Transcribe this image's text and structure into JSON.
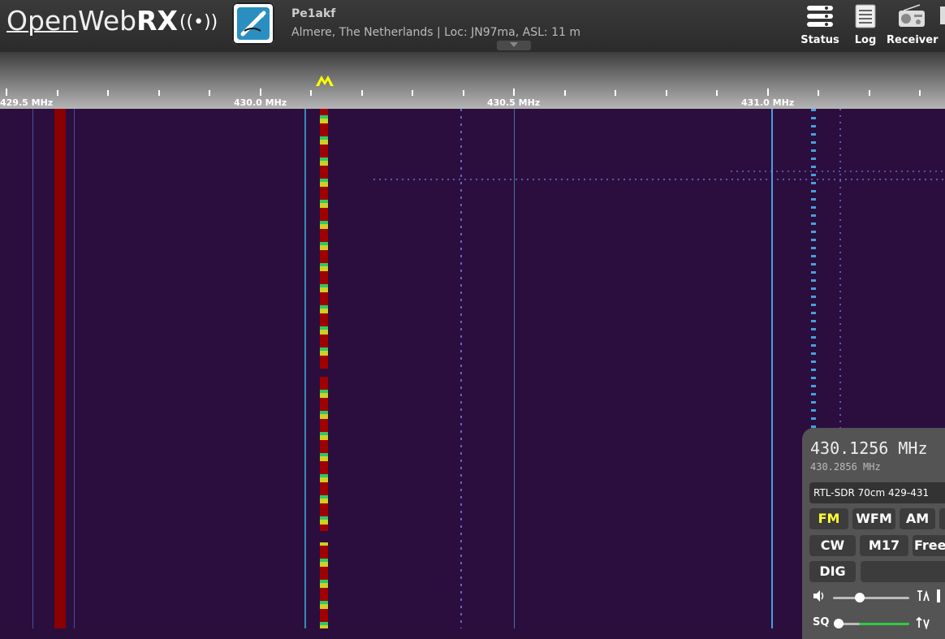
{
  "header": {
    "logo": {
      "part1": "Open",
      "part2": "Web",
      "part3": "RX",
      "waves": "((•))"
    },
    "receiver_name": "Pe1akf",
    "receiver_desc": "Almere, The Netherlands | Loc: JN97ma, ASL: 11 m",
    "buttons": [
      {
        "label": "Status",
        "icon": "status-icon"
      },
      {
        "label": "Log",
        "icon": "log-icon"
      },
      {
        "label": "Receiver",
        "icon": "receiver-icon"
      }
    ]
  },
  "scale": {
    "labels": [
      "429.5 MHz",
      "430.0 MHz",
      "430.5 MHz",
      "431.0 MHz"
    ],
    "tuning_marker_color": "#ffff00"
  },
  "panel": {
    "frequency": "430.1256 MHz",
    "offset_frequency": "430.2856 MHz",
    "profile": "RTL-SDR 70cm 429-431",
    "modes_row1": [
      "FM",
      "WFM",
      "AM"
    ],
    "modes_row2": [
      "CW",
      "M17",
      "Free"
    ],
    "modes_row3": [
      "DIG"
    ],
    "active_mode": "FM",
    "squelch_label": "SQ",
    "volume_level": 0.35,
    "squelch_level": 0.0
  },
  "colors": {
    "waterfall_bg": "#2b0e3e",
    "strong_signal": "#8b0000",
    "accent_active": "#ffff33"
  }
}
